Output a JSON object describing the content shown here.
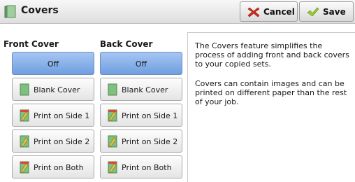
{
  "header": {
    "title": "Covers",
    "icon": "covers-icon",
    "cancel_label": "Cancel",
    "save_label": "Save"
  },
  "front": {
    "heading": "Front Cover",
    "options": [
      {
        "label": "Off",
        "selected": true
      },
      {
        "label": "Blank Cover",
        "icon": "blank-cover-icon"
      },
      {
        "label": "Print on Side 1",
        "icon": "print-side1-icon"
      },
      {
        "label": "Print on Side 2",
        "icon": "print-side2-icon"
      },
      {
        "label": "Print on Both",
        "icon": "print-both-icon"
      }
    ]
  },
  "back": {
    "heading": "Back Cover",
    "options": [
      {
        "label": "Off",
        "selected": true
      },
      {
        "label": "Blank Cover",
        "icon": "blank-cover-icon"
      },
      {
        "label": "Print on Side 1",
        "icon": "print-side1-icon"
      },
      {
        "label": "Print on Side 2",
        "icon": "print-side2-icon"
      },
      {
        "label": "Print on Both",
        "icon": "print-both-icon"
      }
    ]
  },
  "info": {
    "paragraph1": "The Covers feature simplifies the process of adding front and back covers to your copied sets.",
    "paragraph2": "Covers can contain images and can be printed on different paper than the rest of your job."
  },
  "colors": {
    "selected": "#7fa8e6",
    "cover_green": "#7fbf7f",
    "cancel_red": "#d22b1f",
    "save_green": "#7dbb2a"
  }
}
